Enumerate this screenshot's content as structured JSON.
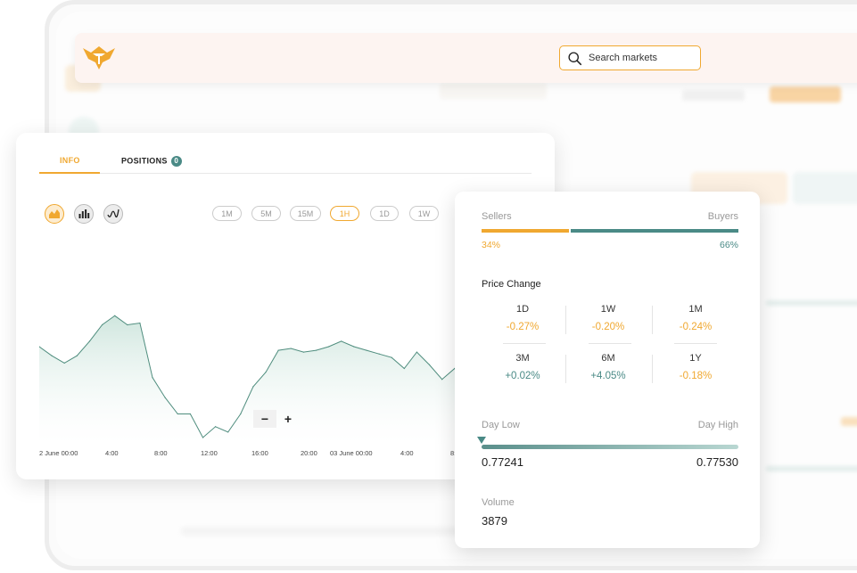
{
  "search": {
    "placeholder": "Search markets"
  },
  "tabs": [
    {
      "label": "INFO",
      "active": true
    },
    {
      "label": "POSITIONS",
      "badge": "0",
      "active": false
    }
  ],
  "chart_types": [
    {
      "icon": "area-chart-icon",
      "active": true
    },
    {
      "icon": "candlestick-chart-icon",
      "active": false
    },
    {
      "icon": "line-chart-icon",
      "active": false
    }
  ],
  "intervals": [
    {
      "label": "1M",
      "active": false
    },
    {
      "label": "5M",
      "active": false
    },
    {
      "label": "15M",
      "active": false
    },
    {
      "label": "1H",
      "active": true
    },
    {
      "label": "1D",
      "active": false
    },
    {
      "label": "1W",
      "active": false
    }
  ],
  "zoom": {
    "minus": "−",
    "plus": "+"
  },
  "chart_data": {
    "type": "area",
    "x_ticks": [
      "2 June 00:00",
      "4:00",
      "8:00",
      "12:00",
      "16:00",
      "20:00",
      "03 June 00:00",
      "4:00",
      "8:"
    ],
    "values": [
      0.5,
      0.45,
      0.41,
      0.45,
      0.53,
      0.62,
      0.67,
      0.62,
      0.63,
      0.33,
      0.22,
      0.13,
      0.13,
      0.0,
      0.06,
      0.03,
      0.13,
      0.28,
      0.36,
      0.48,
      0.49,
      0.47,
      0.48,
      0.5,
      0.53,
      0.5,
      0.48,
      0.46,
      0.44,
      0.38,
      0.47,
      0.4,
      0.32,
      0.38,
      0.3,
      0.24
    ],
    "ylim": [
      0,
      1
    ],
    "color": "#4f8d7e",
    "fill_top": "#cfe6de"
  },
  "stats": {
    "sellers_label": "Sellers",
    "buyers_label": "Buyers",
    "sellers_pct": "34%",
    "buyers_pct": "66%",
    "sellers_fraction": 0.34,
    "price_change_title": "Price Change",
    "price_changes": [
      {
        "period": "1D",
        "value": "-0.27%",
        "sign": "neg"
      },
      {
        "period": "1W",
        "value": "-0.20%",
        "sign": "neg"
      },
      {
        "period": "1M",
        "value": "-0.24%",
        "sign": "neg"
      },
      {
        "period": "3M",
        "value": "+0.02%",
        "sign": "pos"
      },
      {
        "period": "6M",
        "value": "+4.05%",
        "sign": "pos"
      },
      {
        "period": "1Y",
        "value": "-0.18%",
        "sign": "neg"
      }
    ],
    "day_low_label": "Day Low",
    "day_high_label": "Day High",
    "day_low": "0.77241",
    "day_high": "0.77530",
    "volume_label": "Volume",
    "volume": "3879"
  },
  "colors": {
    "accent": "#f0a830",
    "teal": "#4a8a86",
    "negative": "#f0a830",
    "positive": "#4a8a86"
  }
}
